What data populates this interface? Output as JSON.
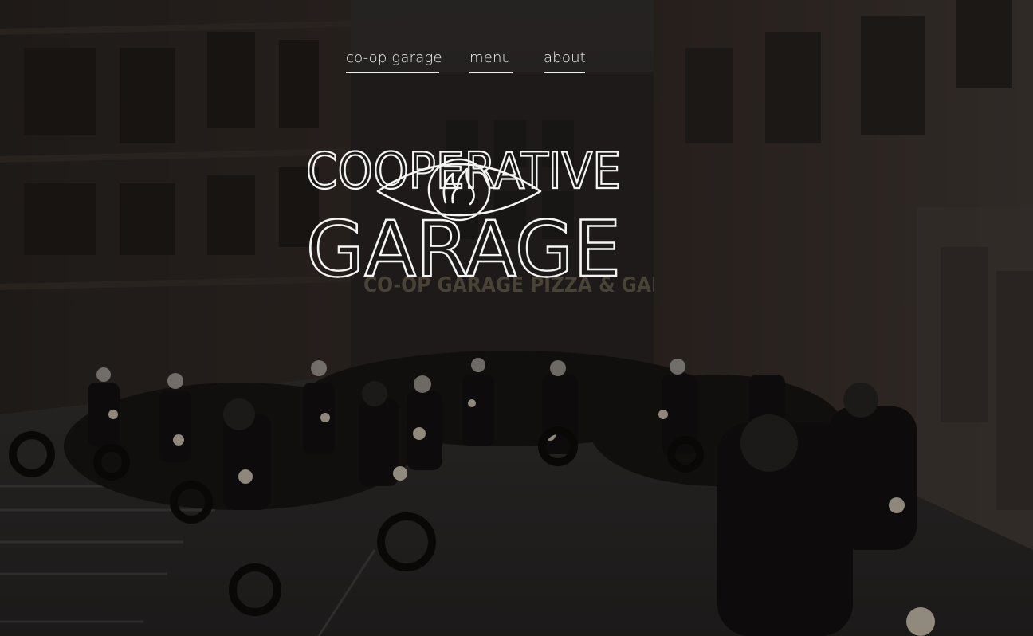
{
  "nav": {
    "items": [
      {
        "label": "co-op garage"
      },
      {
        "label": "menu"
      },
      {
        "label": "about"
      }
    ]
  },
  "logo": {
    "line1": "COOPERATIVE",
    "line2": "GARAGE",
    "emblem_icon": "eye-flame-icon"
  },
  "background": {
    "sign_text": "CO-OP GARAGE PIZZA & GARDEN"
  },
  "colors": {
    "overlay": "#1c1a19",
    "text": "#f2f2f2",
    "sign": "#a89878"
  }
}
